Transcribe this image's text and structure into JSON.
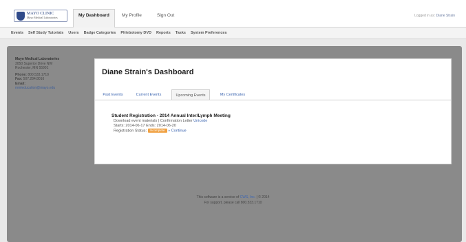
{
  "header": {
    "logo": {
      "line1": "MAYO CLINIC",
      "line2": "Mayo Medical Laboratories"
    },
    "tabs": [
      "My Dashboard",
      "My Profile",
      "Sign Out"
    ],
    "logged_in_prefix": "Logged in as:",
    "logged_in_user": "Diane Strain"
  },
  "nav": {
    "items": [
      "Events",
      "Self Study Tutorials",
      "Users",
      "Badge Categories",
      "Phlebotomy DVD",
      "Reports",
      "Tasks",
      "System Preferences"
    ]
  },
  "sidebar": {
    "org": "Mayo Medical Laboratories",
    "address1": "3050 Superior Drive NW",
    "address2": "Rochester, MN 55901",
    "phone_label": "Phone:",
    "phone": "800.533.1710",
    "fax_label": "Fax:",
    "fax": "507.284.8016",
    "email_label": "Email:",
    "email": "mmleducation@mayo.edu"
  },
  "main": {
    "title": "Diane Strain's Dashboard",
    "tabs": [
      "Past Events",
      "Current Events",
      "Upcoming Events",
      "My Certificates"
    ],
    "event": {
      "title": "Student Registration - 2014 Annual Inter/Lymph Meeting",
      "materials_text": "Download event materials | Confirmation Letter",
      "unicode_link": "Unicode",
      "dates": "Starts: 2014-06-17  Ends: 2014-06-20",
      "status_label": "Registration Status:",
      "status_badge": "Incomplete",
      "continue_link": "» Continue"
    }
  },
  "footer": {
    "line1_prefix": "This software is a service of",
    "company": "CWS, Inc.",
    "line1_suffix": "| © 2014",
    "line2": "For support, please call 800.533.1710"
  },
  "colors": {
    "accent_link": "#3e67b1",
    "badge": "#f0a040",
    "frame": "#8a8a8a"
  }
}
